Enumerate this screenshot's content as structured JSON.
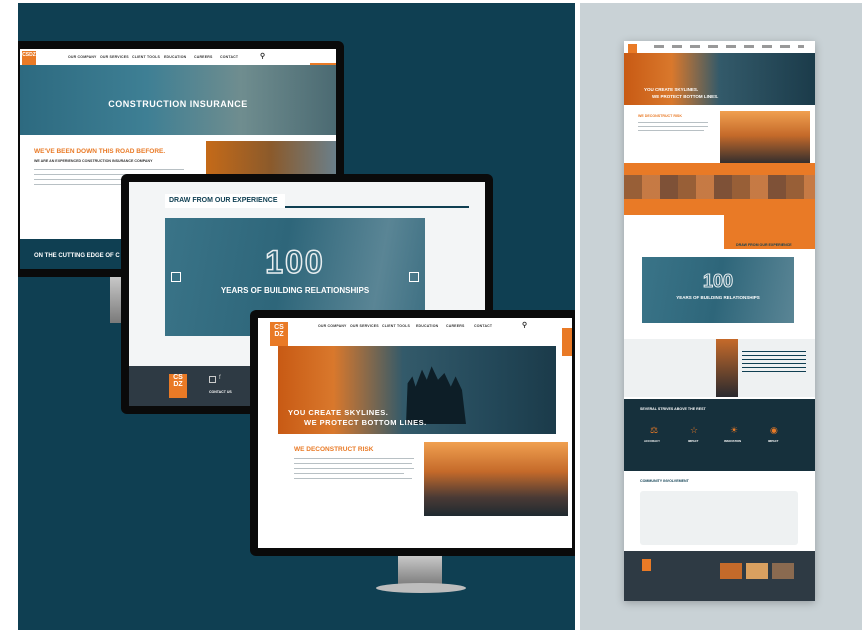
{
  "monitor_back": {
    "nav": [
      "OUR COMPANY",
      "OUR SERVICES",
      "CLIENT TOOLS",
      "EDUCATION",
      "CAREERS",
      "CONTACT"
    ],
    "logo": "CSDZ",
    "hero_title": "CONSTRUCTION INSURANCE",
    "section_title": "WE'VE BEEN DOWN THIS ROAD BEFORE.",
    "section_sub": "WE ARE AN EXPERIENCED CONSTRUCTION INSURANCE COMPANY",
    "footer_title": "ON THE CUTTING EDGE OF C"
  },
  "monitor_middle": {
    "heading": "DRAW FROM OUR EXPERIENCE",
    "big_number": "100",
    "tagline": "YEARS OF BUILDING RELATIONSHIPS",
    "logo_lines": [
      "CS",
      "DZ"
    ],
    "footer_link": "CONTACT US"
  },
  "monitor_front": {
    "nav": [
      "OUR COMPANY",
      "OUR SERVICES",
      "CLIENT TOOLS",
      "EDUCATION",
      "CAREERS",
      "CONTACT"
    ],
    "logo_lines": [
      "CS",
      "DZ"
    ],
    "hero_line1": "YOU CREATE SKYLINES.",
    "hero_line2": "WE PROTECT BOTTOM LINES.",
    "section_title": "WE DECONSTRUCT RISK"
  },
  "right_page": {
    "hero_line1": "YOU CREATE SKYLINES.",
    "hero_line2": "WE PROTECT BOTTOM LINES.",
    "section1": "WE DECONSTRUCT RISK",
    "experience": "DRAW FROM OUR EXPERIENCE",
    "big_number": "100",
    "tagline": "YEARS OF BUILDING RELATIONSHIPS",
    "strive": "SEVERAL STRIVES ABOVE THE REST",
    "community": "COMMUNITY INVOLVEMENT",
    "icon_labels": [
      "ACCURACY",
      "IMPACT",
      "INNOVATION",
      "IMPACT"
    ]
  },
  "colors": {
    "accent": "#e97a26",
    "dark": "#0f3f52",
    "teal": "#2b6d82"
  }
}
